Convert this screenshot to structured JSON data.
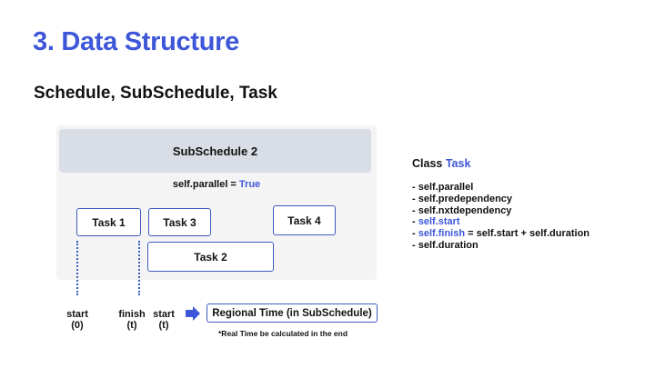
{
  "title": "3. Data Structure",
  "subtitle": "Schedule, SubSchedule, Task",
  "subschedule": {
    "label": "SubSchedule 2",
    "parallel_label": "self.parallel = ",
    "parallel_value": "True"
  },
  "tasks": {
    "task1": "Task 1",
    "task2": "Task 2",
    "task3": "Task 3",
    "task4": "Task 4"
  },
  "timeline": {
    "start_label": "start",
    "start_value": "(0)",
    "finish_label": "finish",
    "finish_value": "(t)",
    "start2_label": "start",
    "start2_value": "(t)",
    "regional_label": "Regional Time (in SubSchedule)",
    "note": "*Real Time be calculated in the end"
  },
  "class_info": {
    "prefix": "Class ",
    "name": "Task",
    "attributes": [
      {
        "text": "self.parallel",
        "highlight": false,
        "suffix": ""
      },
      {
        "text": "self.predependency",
        "highlight": false,
        "suffix": ""
      },
      {
        "text": "self.nxtdependency",
        "highlight": false,
        "suffix": ""
      },
      {
        "text": "self.start",
        "highlight": true,
        "suffix": ""
      },
      {
        "text": "self.finish",
        "highlight": true,
        "suffix": " = self.start + self.duration"
      },
      {
        "text": "self.duration",
        "highlight": false,
        "suffix": ""
      }
    ]
  },
  "colors": {
    "accent": "#3d57d8",
    "panel": "#f4f4f5",
    "header": "#d9dde5",
    "border": "#3d5bbf"
  }
}
